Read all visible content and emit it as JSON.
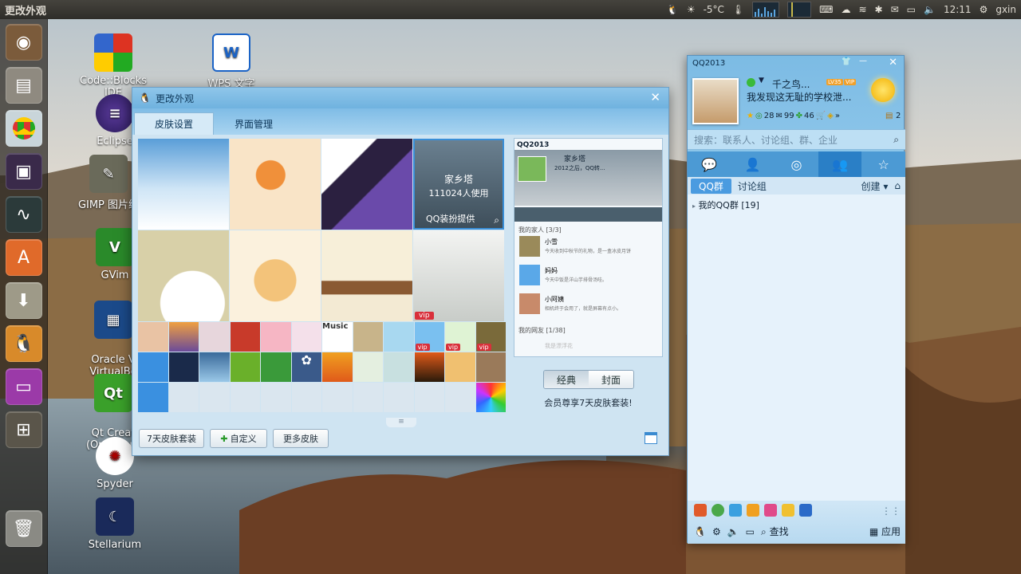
{
  "topbar": {
    "app_title": "更改外观",
    "temperature": "-5°C",
    "time": "12:11",
    "user": "gxin"
  },
  "desktop_icons": [
    {
      "label": "Code::Blocks IDE"
    },
    {
      "label": "WPS 文字"
    },
    {
      "label": "Eclipse"
    },
    {
      "label": "GIMP 图片编"
    },
    {
      "label": "GVim"
    },
    {
      "label": "Oracle V\nVirtualBo"
    },
    {
      "label": "Qt Creat\n(Opensour"
    },
    {
      "label": "Spyder"
    },
    {
      "label": "Stellarium"
    }
  ],
  "skin_window": {
    "title": "更改外观",
    "tabs": [
      {
        "label": "皮肤设置"
      },
      {
        "label": "界面管理"
      }
    ],
    "hover_tile": {
      "name": "家乡塔",
      "count": "111024人使用",
      "provider": "QQ装扮提供"
    },
    "preview": {
      "title": "QQ2013",
      "nick": "家乡塔",
      "sign": "2012之后，QQ转...",
      "group_family": "我的家人 [3/3]",
      "contacts": [
        {
          "name": "小雪",
          "msg": "今天收到中秋节的礼物，是一盒冰皮月饼"
        },
        {
          "name": "妈妈",
          "msg": "今天中饭是洋山芋排骨汤哇。"
        },
        {
          "name": "小阿姨",
          "msg": "相机终于会用了，就是屏幕有点小。"
        }
      ],
      "group_friends": "我的网友 [1/38]",
      "faded": "我是漂浮花"
    },
    "mode_buttons": [
      {
        "label": "经典"
      },
      {
        "label": "封面"
      }
    ],
    "promo": "会员尊享7天皮肤套装!",
    "buttons": {
      "trial": "7天皮肤套装",
      "custom": "自定义",
      "more": "更多皮肤"
    },
    "vip_label": "vip"
  },
  "qq_panel": {
    "title": "QQ2013",
    "nickname": "千之鸟...",
    "level_badge": "LV35",
    "vip_badge": "VIP",
    "signature": "我发现这无耻的学校泄...",
    "stats": [
      "28",
      "99",
      "46"
    ],
    "stat_right": "2",
    "search_placeholder": "搜索：联系人、讨论组、群、企业",
    "subtabs": {
      "qq_group": "QQ群",
      "discuss": "讨论组",
      "create": "创建"
    },
    "group_item": {
      "name": "我的QQ群",
      "count": "[19]"
    },
    "bottom": {
      "find": "查找",
      "apps": "应用"
    }
  }
}
